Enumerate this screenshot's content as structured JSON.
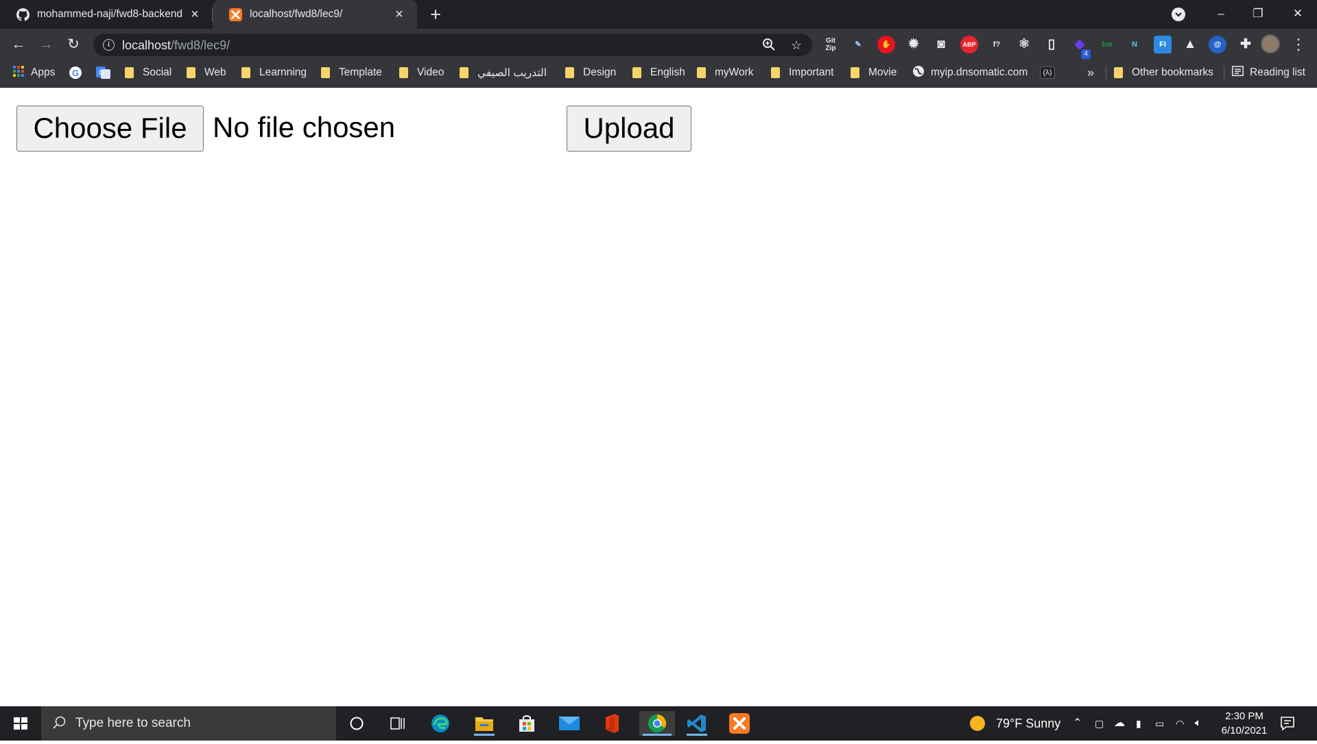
{
  "tabs": [
    {
      "title": "mohammed-naji/fwd8-backend",
      "icon": "github-icon",
      "active": false
    },
    {
      "title": "localhost/fwd8/lec9/",
      "icon": "xampp-icon",
      "active": true
    }
  ],
  "tab_close_symbol": "×",
  "new_tab_symbol": "+",
  "window_controls": {
    "minimize": "–",
    "restore": "❐",
    "close": "✕"
  },
  "toolbar": {
    "url_host": "localhost",
    "url_path": "/fwd8/lec9/",
    "info_symbol": "i",
    "extensions": [
      {
        "name": "gitzip-extension-icon",
        "label": "Git\nZip",
        "color": "#e8eaed"
      },
      {
        "name": "pen-extension-icon",
        "label": "✎",
        "color": "#9ecbff"
      },
      {
        "name": "stop-hand-extension-icon",
        "label": "✋",
        "color": "#ff3333"
      },
      {
        "name": "gear-extension-icon",
        "label": "✹",
        "color": "#e8eaed"
      },
      {
        "name": "camera-extension-icon",
        "label": "◙",
        "color": "#e8eaed"
      },
      {
        "name": "adblock-plus-icon",
        "label": "ABP",
        "color": "#ffffff"
      },
      {
        "name": "font-extension-icon",
        "label": "f?",
        "color": "#e8eaed"
      },
      {
        "name": "react-devtools-icon",
        "label": "⚛",
        "color": "#e8eaed"
      },
      {
        "name": "device-extension-icon",
        "label": "▯",
        "color": "#e8eaed"
      },
      {
        "name": "puzzle-purple-extension-icon",
        "label": "◆",
        "color": "#6a3de8"
      },
      {
        "name": "bw-extension-icon",
        "label": "bw",
        "color": "#1e8e3e"
      },
      {
        "name": "n-extension-icon",
        "label": "N",
        "color": "#5ec7f2"
      },
      {
        "name": "fi-extension-icon",
        "label": "FI",
        "color": "#ffffff"
      },
      {
        "name": "triangle-extension-icon",
        "label": "▲",
        "color": "#e8eaed"
      },
      {
        "name": "at-extension-icon",
        "label": "@",
        "color": "#ffffff"
      },
      {
        "name": "extensions-puzzle-icon",
        "label": "✚",
        "color": "#e8eaed"
      }
    ],
    "badge_count": "4",
    "menu_symbol": "⋮"
  },
  "bookmarks": {
    "apps_label": "Apps",
    "items": [
      "Social",
      "Web",
      "Learnning",
      "Template",
      "Video",
      "التدريب الصيفي",
      "Design",
      "English",
      "myWork",
      "Important",
      "Movie"
    ],
    "site_label": "myip.dnsomatic.com",
    "overflow": "»",
    "other_label": "Other bookmarks",
    "reading_list_label": "Reading list"
  },
  "page": {
    "choose_file_label": "Choose File",
    "no_file_text": "No file chosen",
    "upload_label": "Upload"
  },
  "taskbar": {
    "search_placeholder": "Type here to search",
    "weather": "79°F  Sunny",
    "time": "2:30 PM",
    "date": "6/10/2021",
    "active_app": "chrome-taskbar-icon"
  }
}
